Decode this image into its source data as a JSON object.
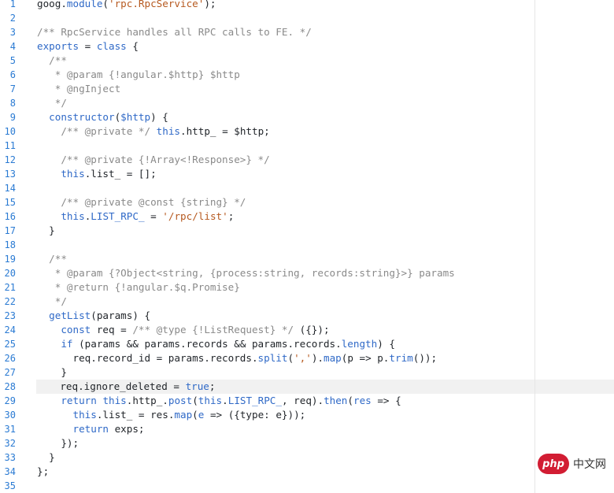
{
  "gutter": {
    "lines": [
      "1",
      "2",
      "3",
      "4",
      "5",
      "6",
      "7",
      "8",
      "9",
      "10",
      "11",
      "12",
      "13",
      "14",
      "15",
      "16",
      "17",
      "18",
      "19",
      "20",
      "21",
      "22",
      "23",
      "24",
      "25",
      "26",
      "27",
      "28",
      "29",
      "30",
      "31",
      "32",
      "33",
      "34",
      "35"
    ]
  },
  "code": {
    "current_line": 28,
    "lines": [
      [
        [
          "p",
          "goog."
        ],
        [
          "k",
          "module"
        ],
        [
          "p",
          "("
        ],
        [
          "s",
          "'rpc.RpcService'"
        ],
        [
          "p",
          ");"
        ]
      ],
      [],
      [
        [
          "c",
          "/** RpcService handles all RPC calls to FE. */"
        ]
      ],
      [
        [
          "k",
          "exports"
        ],
        [
          "p",
          " = "
        ],
        [
          "k",
          "class"
        ],
        [
          "p",
          " {"
        ]
      ],
      [
        [
          "c",
          "  /**"
        ]
      ],
      [
        [
          "c",
          "   * @param {!angular.$http} $http"
        ]
      ],
      [
        [
          "c",
          "   * @ngInject"
        ]
      ],
      [
        [
          "c",
          "   */"
        ]
      ],
      [
        [
          "p",
          "  "
        ],
        [
          "k",
          "constructor"
        ],
        [
          "p",
          "("
        ],
        [
          "k",
          "$http"
        ],
        [
          "p",
          ") {"
        ]
      ],
      [
        [
          "p",
          "    "
        ],
        [
          "c",
          "/** @private */"
        ],
        [
          "p",
          " "
        ],
        [
          "k",
          "this"
        ],
        [
          "p",
          ".http_ = $http;"
        ]
      ],
      [],
      [
        [
          "p",
          "    "
        ],
        [
          "c",
          "/** @private {!Array<!Response>} */"
        ]
      ],
      [
        [
          "p",
          "    "
        ],
        [
          "k",
          "this"
        ],
        [
          "p",
          ".list_ = [];"
        ]
      ],
      [],
      [
        [
          "p",
          "    "
        ],
        [
          "c",
          "/** @private @const {string} */"
        ]
      ],
      [
        [
          "p",
          "    "
        ],
        [
          "k",
          "this"
        ],
        [
          "p",
          "."
        ],
        [
          "k",
          "LIST_RPC_"
        ],
        [
          "p",
          " = "
        ],
        [
          "s",
          "'/rpc/list'"
        ],
        [
          "p",
          ";"
        ]
      ],
      [
        [
          "p",
          "  }"
        ]
      ],
      [],
      [
        [
          "c",
          "  /**"
        ]
      ],
      [
        [
          "c",
          "   * @param {?Object<string, {process:string, records:string}>} params"
        ]
      ],
      [
        [
          "c",
          "   * @return {!angular.$q.Promise}"
        ]
      ],
      [
        [
          "c",
          "   */"
        ]
      ],
      [
        [
          "p",
          "  "
        ],
        [
          "k",
          "getList"
        ],
        [
          "p",
          "(params) {"
        ]
      ],
      [
        [
          "p",
          "    "
        ],
        [
          "k",
          "const"
        ],
        [
          "p",
          " req = "
        ],
        [
          "c",
          "/** @type {!ListRequest} */"
        ],
        [
          "p",
          " ({});"
        ]
      ],
      [
        [
          "p",
          "    "
        ],
        [
          "k",
          "if"
        ],
        [
          "p",
          " (params && params.records && params.records."
        ],
        [
          "k",
          "length"
        ],
        [
          "p",
          ") {"
        ]
      ],
      [
        [
          "p",
          "      req.record_id = params.records."
        ],
        [
          "k",
          "split"
        ],
        [
          "p",
          "("
        ],
        [
          "s",
          "','"
        ],
        [
          "p",
          ")."
        ],
        [
          "k",
          "map"
        ],
        [
          "p",
          "(p => p."
        ],
        [
          "k",
          "trim"
        ],
        [
          "p",
          "());"
        ]
      ],
      [
        [
          "p",
          "    }"
        ]
      ],
      [
        [
          "p",
          "    req.ignore_deleted = "
        ],
        [
          "k",
          "true"
        ],
        [
          "p",
          ";"
        ]
      ],
      [
        [
          "p",
          "    "
        ],
        [
          "k",
          "return"
        ],
        [
          "p",
          " "
        ],
        [
          "k",
          "this"
        ],
        [
          "p",
          ".http_."
        ],
        [
          "k",
          "post"
        ],
        [
          "p",
          "("
        ],
        [
          "k",
          "this"
        ],
        [
          "p",
          "."
        ],
        [
          "k",
          "LIST_RPC_"
        ],
        [
          "p",
          ", req)."
        ],
        [
          "k",
          "then"
        ],
        [
          "p",
          "("
        ],
        [
          "k",
          "res"
        ],
        [
          "p",
          " => {"
        ]
      ],
      [
        [
          "p",
          "      "
        ],
        [
          "k",
          "this"
        ],
        [
          "p",
          ".list_ = res."
        ],
        [
          "k",
          "map"
        ],
        [
          "p",
          "("
        ],
        [
          "k",
          "e"
        ],
        [
          "p",
          " => ({type: e}));"
        ]
      ],
      [
        [
          "p",
          "      "
        ],
        [
          "k",
          "return"
        ],
        [
          "p",
          " exps;"
        ]
      ],
      [
        [
          "p",
          "    });"
        ]
      ],
      [
        [
          "p",
          "  }"
        ]
      ],
      [
        [
          "p",
          "};"
        ]
      ],
      []
    ]
  },
  "watermark": {
    "logo": "php",
    "text": "中文网"
  },
  "colors": {
    "line_number": "#2b7bd3",
    "keyword": "#2f69c7",
    "string": "#b6591f",
    "comment": "#8a8a8a",
    "current_line_bg": "#f1f1f1",
    "watermark_red": "#d21d33"
  }
}
